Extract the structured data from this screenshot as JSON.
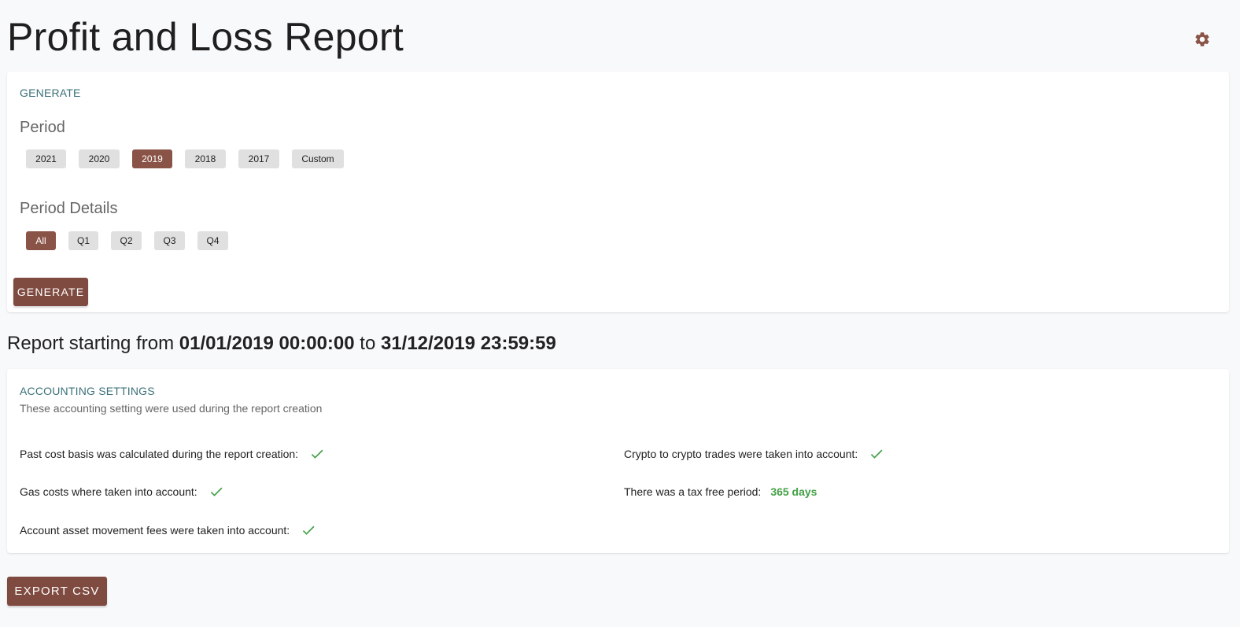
{
  "header": {
    "title": "Profit and Loss Report",
    "settings_icon": "gear-icon"
  },
  "generate": {
    "heading": "GENERATE",
    "period_title": "Period",
    "periods": [
      "2021",
      "2020",
      "2019",
      "2018",
      "2017",
      "Custom"
    ],
    "selected_period": "2019",
    "details_title": "Period Details",
    "details": [
      "All",
      "Q1",
      "Q2",
      "Q3",
      "Q4"
    ],
    "selected_detail": "All",
    "button_label": "GENERATE"
  },
  "report": {
    "prefix": "Report starting from ",
    "start": "01/01/2019 00:00:00",
    "middle": " to ",
    "end": "31/12/2019 23:59:59"
  },
  "accounting": {
    "heading": "ACCOUNTING SETTINGS",
    "subtitle": "These accounting setting were used during the report creation",
    "past_cost_basis": "Past cost basis was calculated during the report creation:",
    "gas_costs": "Gas costs where taken into account:",
    "asset_movement_fees": "Account asset movement fees were taken into account:",
    "crypto_to_crypto": "Crypto to crypto trades were taken into account:",
    "tax_free_period": "There was a tax free period:",
    "tax_free_days": "365 days"
  },
  "export": {
    "button_label": "EXPORT CSV"
  },
  "colors": {
    "accent": "#7f4a3f",
    "heading_teal": "#3a7078",
    "success": "#43a047"
  }
}
